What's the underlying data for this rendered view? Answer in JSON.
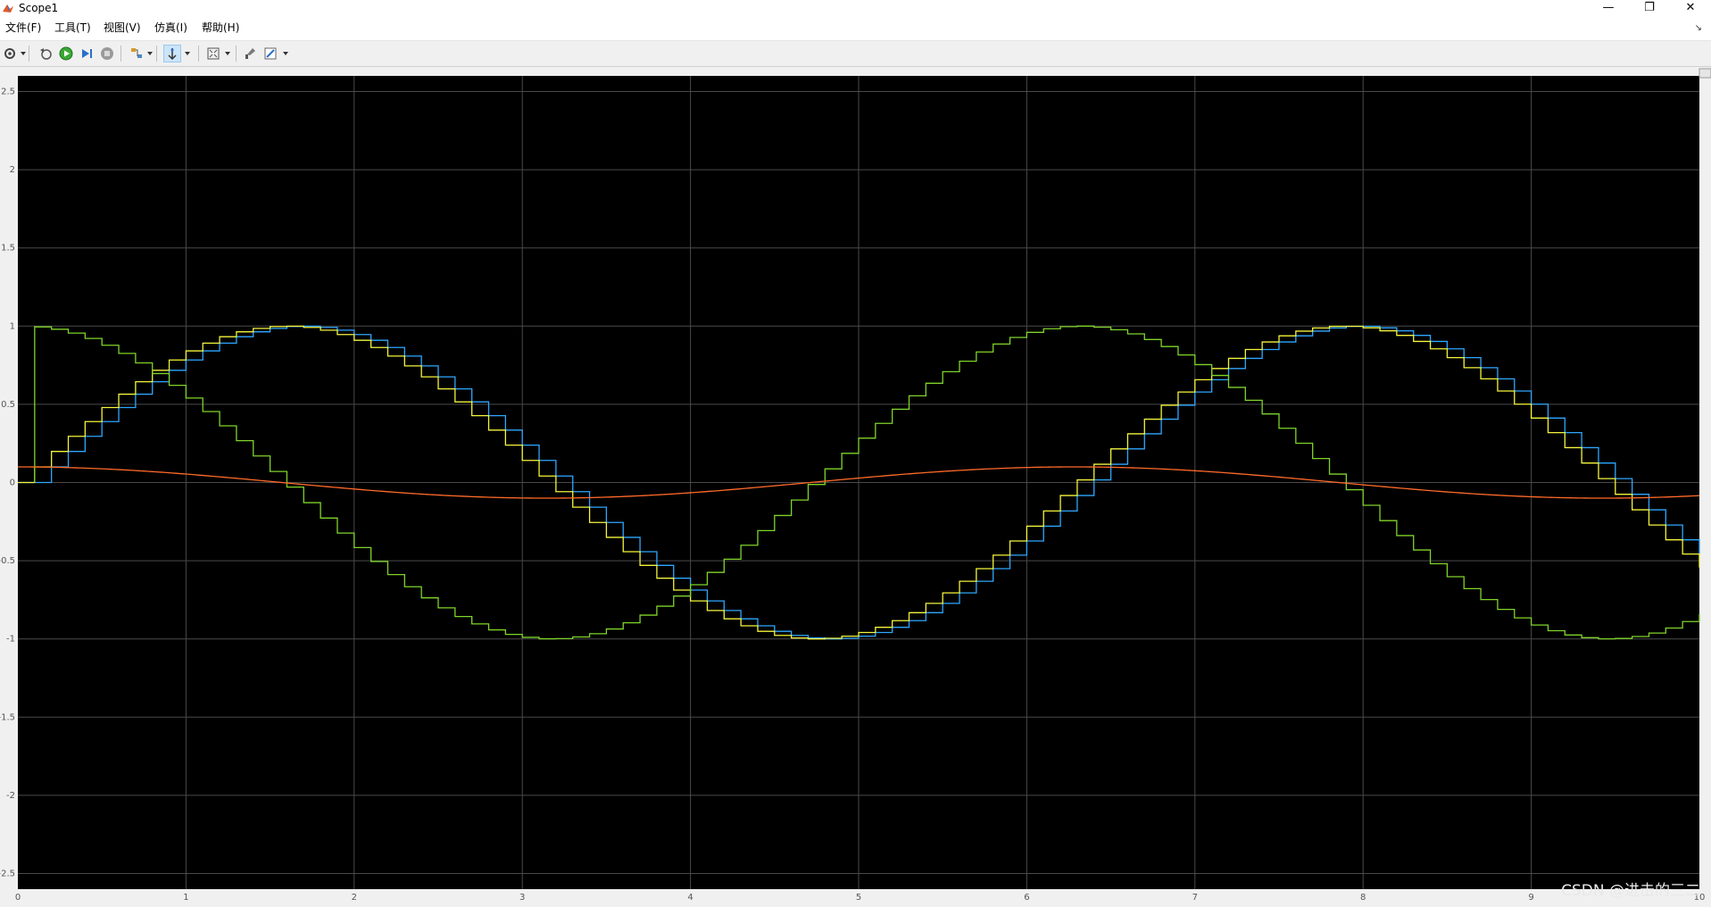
{
  "window": {
    "title": "Scope1",
    "minimize": "—",
    "restore": "❐",
    "close": "✕"
  },
  "menu": {
    "items": [
      "文件(F)",
      "工具(T)",
      "视图(V)",
      "仿真(I)",
      "帮助(H)"
    ],
    "corner": "↘"
  },
  "toolbar": {
    "buttons": [
      "settings-icon",
      "step-back-icon",
      "run-icon",
      "step-forward-icon",
      "stop-icon",
      "signal-highlight-icon",
      "cursor-icon",
      "zoom-fit-icon",
      "style-icon",
      "edit-icon"
    ]
  },
  "watermark": "CSDN @进击的三二",
  "chart_data": {
    "type": "line",
    "x_range": [
      0,
      10
    ],
    "y_range": [
      -2.6,
      2.6
    ],
    "x_ticks": [
      "0",
      "1",
      "2",
      "3",
      "4",
      "5",
      "6",
      "7",
      "8",
      "9",
      "10"
    ],
    "y_ticks": [
      "2.5",
      "2",
      "1.5",
      "1",
      "0.5",
      "0",
      "-0.5",
      "-1",
      "-1.5",
      "-2",
      "-2.5"
    ],
    "grid": true,
    "background": "#000000",
    "grid_color": "#4a4a4a",
    "series": [
      {
        "color": "#2ea7ff",
        "description": "sin(t) sampled with zero-order hold, sample 0.1, delayed one step",
        "step": 0.1,
        "kind": "sin_delayed"
      },
      {
        "color": "#f5f53d",
        "description": "sin(t) zero-order hold, sample 0.1",
        "step": 0.1,
        "kind": "sin"
      },
      {
        "color": "#7fd42a",
        "description": "cos(t) zero-order hold, sample 0.1",
        "step": 0.1,
        "kind": "cos"
      },
      {
        "color": "#ff6a2a",
        "description": "0.1*cos(t) continuous",
        "kind": "smallcos"
      }
    ]
  }
}
